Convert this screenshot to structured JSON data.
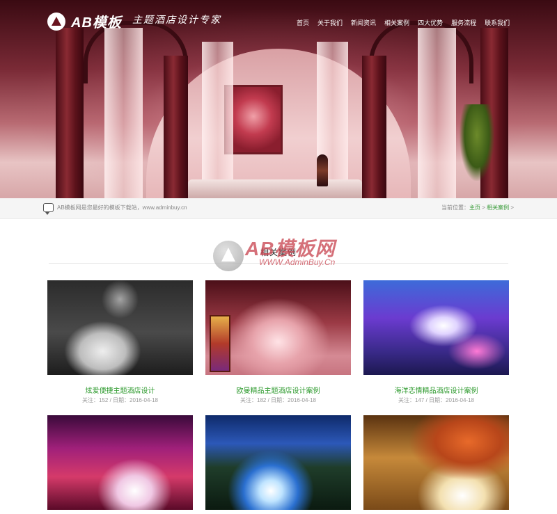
{
  "header": {
    "logo_text": "AB模板",
    "slogan": "主题酒店设计专家",
    "nav": [
      "首页",
      "关于我们",
      "新闻资讯",
      "相关案例",
      "四大优势",
      "服务流程",
      "联系我们"
    ]
  },
  "breadcrumb_bar": {
    "notice": "AB模板网是您最好的模板下载站，www.adminbuy.cn",
    "location_prefix": "当前位置：",
    "home": "主页",
    "separator": " > ",
    "current": "相关案例",
    "trailing": " >"
  },
  "section": {
    "title": "相关案例"
  },
  "watermark": {
    "name": "AB模板网",
    "url": "WWW.AdminBuy.Cn"
  },
  "cases": [
    {
      "title": "炫爱便捷主题酒店设计",
      "meta": "关注：152 / 日期：2016-04-18"
    },
    {
      "title": "欧曼精品主题酒店设计案例",
      "meta": "关注：182 / 日期：2016-04-18"
    },
    {
      "title": "海洋恋情精品酒店设计案例",
      "meta": "关注：147 / 日期：2016-04-18"
    },
    {
      "title": "",
      "meta": ""
    },
    {
      "title": "",
      "meta": ""
    },
    {
      "title": "",
      "meta": ""
    }
  ],
  "colors": {
    "link_green": "#2d9a2d",
    "hero_dark": "#3a0a12"
  }
}
